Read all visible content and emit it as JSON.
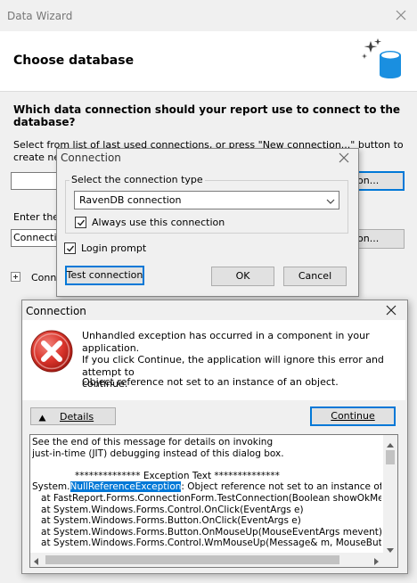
{
  "wizard": {
    "title": "Data Wizard",
    "heading": "Choose database",
    "question": "Which data connection should your report use to connect to the database?",
    "select_text": "Select from list of last used connections, or press \"New connection...\" button to create new conne",
    "new_connection_button": "on...",
    "enter_text": "Enter the c",
    "connection_field_value": "Connection",
    "edit_connection_button": "on...",
    "connection_section_label": "Conne"
  },
  "connection_dialog": {
    "title": "Connection",
    "group_label": "Select the connection type",
    "connection_type_value": "RavenDB connection",
    "always_use_label": "Always use this connection",
    "always_use_checked": true,
    "login_prompt_label": "Login prompt",
    "login_prompt_checked": true,
    "test_button": "Test connection",
    "ok_button": "OK",
    "cancel_button": "Cancel"
  },
  "exception_dialog": {
    "title": "Connection",
    "message_line1": "Unhandled exception has occurred in a component in your application.",
    "message_line2": "If you click Continue, the application will ignore this error and attempt to",
    "message_line3": "continue.",
    "error_message": "Object reference not set to an instance of an object.",
    "details_button": "Details",
    "continue_button": "Continue",
    "details_lines": {
      "l1": "See the end of this message for details on invoking",
      "l2": "just-in-time (JIT) debugging instead of this dialog box.",
      "l3": "************** Exception Text **************",
      "l4_prefix": "System.",
      "l4_highlight": "NullReferenceException",
      "l4_suffix": ": Object reference not set to an instance of an obje",
      "l5": "   at FastReport.Forms.ConnectionForm.TestConnection(Boolean showOkMessage)",
      "l6": "   at System.Windows.Forms.Control.OnClick(EventArgs e)",
      "l7": "   at System.Windows.Forms.Button.OnClick(EventArgs e)",
      "l8": "   at System.Windows.Forms.Button.OnMouseUp(MouseEventArgs mevent)",
      "l9": "   at System.Windows.Forms.Control.WmMouseUp(Message& m, MouseButtons but"
    }
  },
  "colors": {
    "accent": "#0078d7",
    "highlight": "#0078d7",
    "error_red": "#d9342b"
  }
}
